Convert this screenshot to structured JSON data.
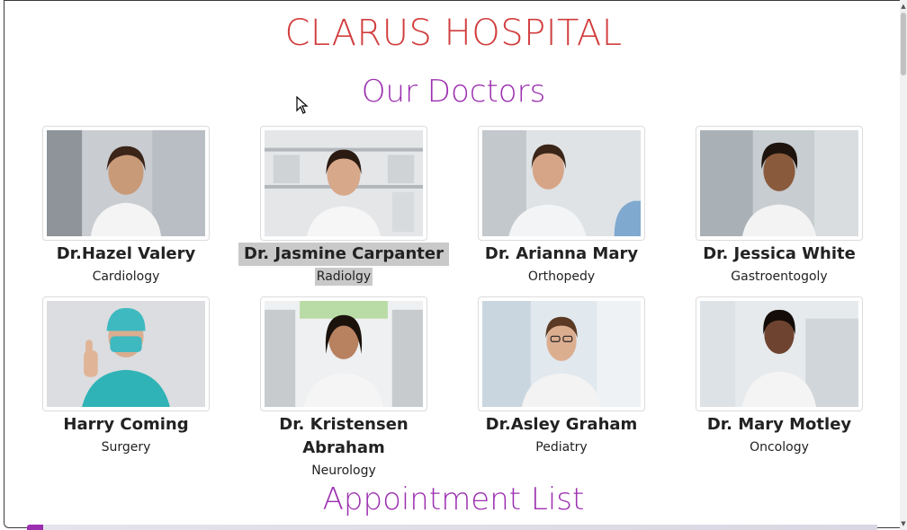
{
  "header": {
    "title": "CLARUS HOSPITAL"
  },
  "doctors_section": {
    "heading": "Our Doctors"
  },
  "doctors": [
    {
      "name": "Dr.Hazel Valery",
      "specialty": "Cardiology",
      "selected": false
    },
    {
      "name": "Dr. Jasmine Carpanter",
      "specialty": "Radiolgy",
      "selected": true
    },
    {
      "name": "Dr. Arianna Mary",
      "specialty": "Orthopedy",
      "selected": false
    },
    {
      "name": "Dr. Jessica White",
      "specialty": "Gastroentogoly",
      "selected": false
    },
    {
      "name": "Harry Coming",
      "specialty": "Surgery",
      "selected": false
    },
    {
      "name": "Dr. Kristensen Abraham",
      "specialty": "Neurology",
      "selected": false
    },
    {
      "name": "Dr.Asley Graham",
      "specialty": "Pediatry",
      "selected": false
    },
    {
      "name": "Dr. Mary Motley",
      "specialty": "Oncology",
      "selected": false
    }
  ],
  "appointments_section": {
    "heading": "Appointment List"
  },
  "colors": {
    "title": "#d23d3d",
    "heading": "#9c2fb0",
    "selection": "#c9c9c9"
  },
  "icons": {
    "cursor": "mouse-pointer-icon",
    "scroll_up": "chevron-up-icon",
    "scroll_down": "chevron-down-icon"
  }
}
